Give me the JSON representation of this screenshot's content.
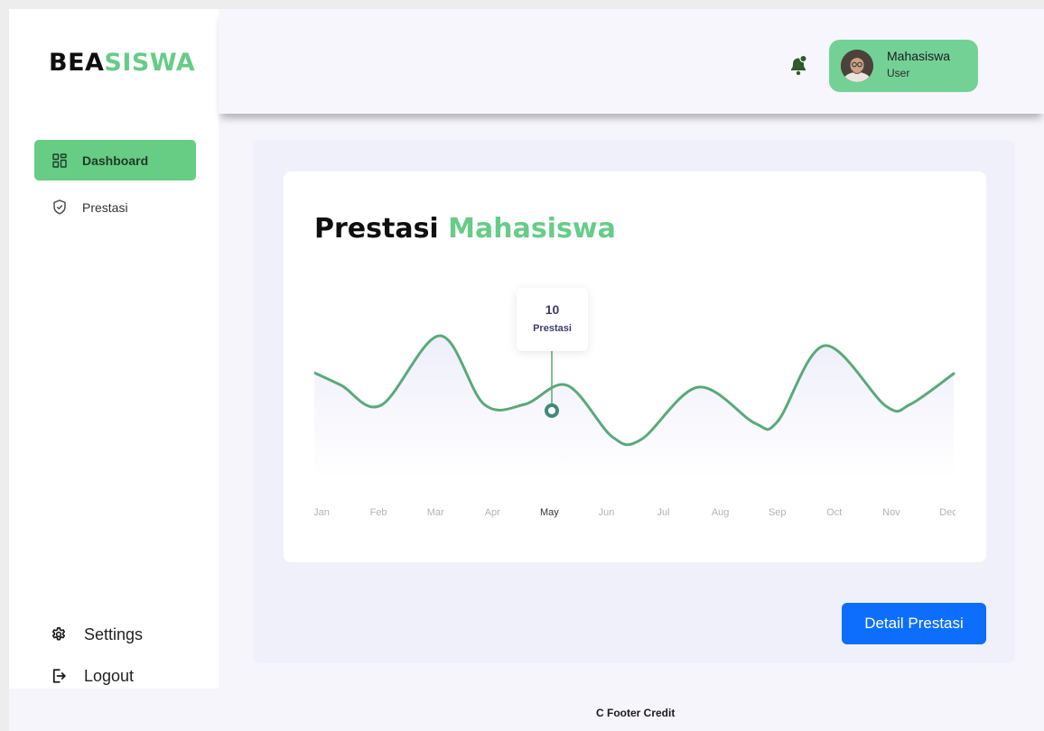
{
  "brand": {
    "part1": "BEA",
    "part2": "SISWA",
    "accent": "#66cc88"
  },
  "sidebar": {
    "items": [
      {
        "label": "Dashboard",
        "icon": "dashboard-grid-icon",
        "active": true
      },
      {
        "label": "Prestasi",
        "icon": "shield-check-icon",
        "active": false
      }
    ],
    "bottom": [
      {
        "label": "Settings",
        "icon": "gear-icon"
      },
      {
        "label": "Logout",
        "icon": "logout-icon"
      }
    ]
  },
  "header": {
    "user": {
      "name": "Mahasiswa",
      "role": "User"
    },
    "bell_icon": "bell-icon",
    "chip_color": "#74d196"
  },
  "card": {
    "title_part1": "Prestasi",
    "title_part2": "Mahasiswa"
  },
  "chart_data": {
    "type": "line",
    "title": "Prestasi Mahasiswa",
    "categories": [
      "Jan",
      "Feb",
      "Mar",
      "Apr",
      "May",
      "Jun",
      "Jul",
      "Aug",
      "Sep",
      "Oct",
      "Nov",
      "Dec"
    ],
    "highlight": {
      "category": "May",
      "value": 10,
      "label": "Prestasi"
    },
    "line_color": "#5aa97a",
    "grid": false
  },
  "detail_button": {
    "label": "Detail Prestasi",
    "color": "#0d6efd"
  },
  "footer": {
    "text": "C Footer Credit"
  }
}
